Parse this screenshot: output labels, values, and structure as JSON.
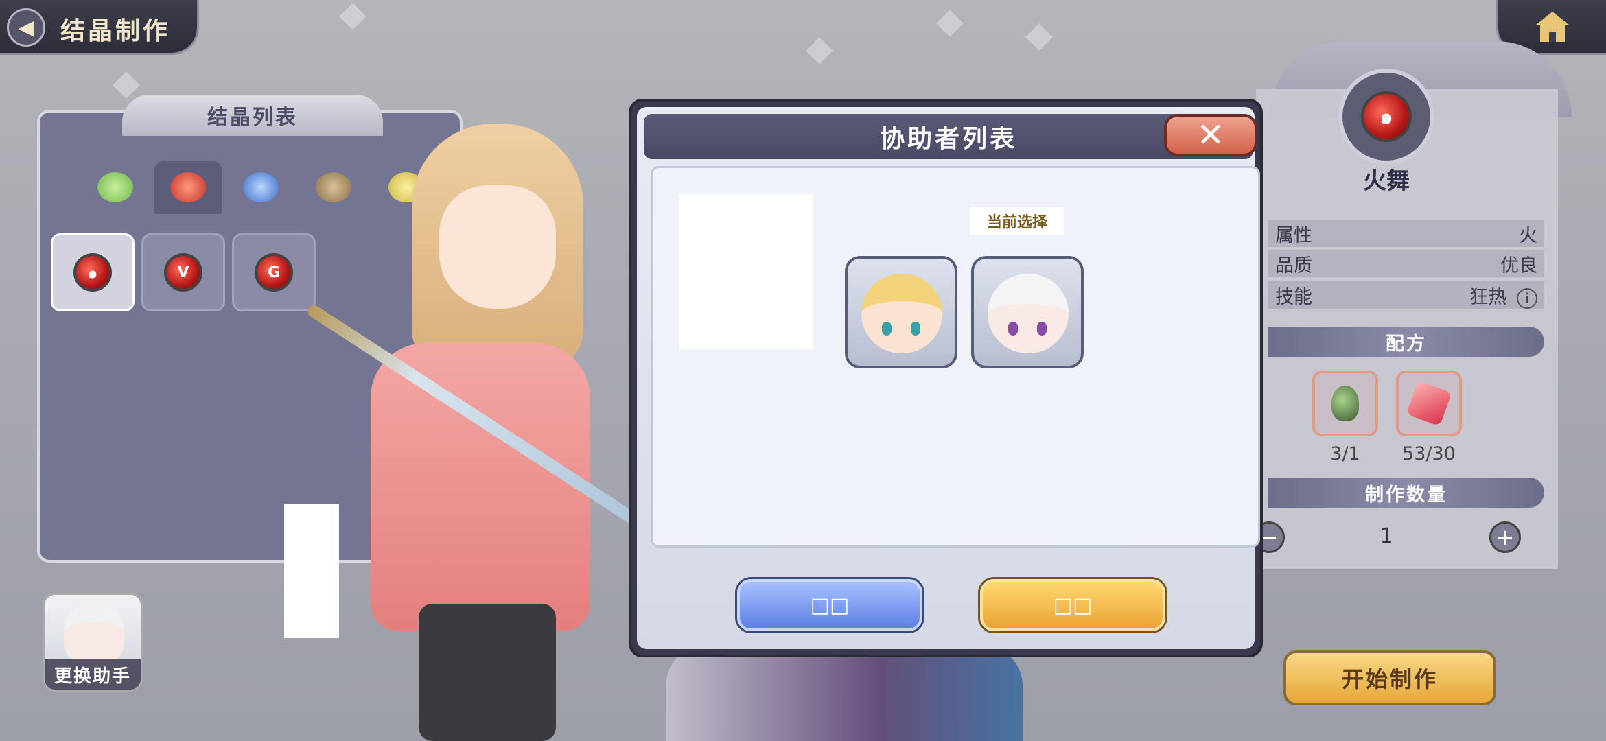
{
  "colors": {
    "accent_gold": "#e7a73a",
    "accent_blue": "#5c7fe4",
    "panel_dark": "#3a3a4f",
    "close_red": "#d2624a"
  },
  "header": {
    "back_icon": "back-arrow-icon",
    "title": "结晶制作",
    "home_icon": "home-icon"
  },
  "crystal_list": {
    "title": "结晶列表",
    "tabs": [
      {
        "icon": "wind-element-icon",
        "color": "#8fd16a",
        "active": false
      },
      {
        "icon": "fire-element-icon",
        "color": "#d84a4a",
        "active": true
      },
      {
        "icon": "water-element-icon",
        "color": "#4d7fd6",
        "active": false
      },
      {
        "icon": "earth-element-icon",
        "color": "#a58a5c",
        "active": false
      },
      {
        "icon": "light-element-icon",
        "color": "#d6c84a",
        "active": false
      },
      {
        "icon": "dark-element-icon",
        "color": "#444444",
        "active": false
      }
    ],
    "items": [
      {
        "icon": "fire-crystal-swirl-icon",
        "glyph": "๑",
        "selected": true
      },
      {
        "icon": "fire-crystal-v-icon",
        "glyph": "V",
        "selected": false
      },
      {
        "icon": "fire-crystal-g-icon",
        "glyph": "G",
        "selected": false
      }
    ]
  },
  "helper_button": {
    "label": "更换助手"
  },
  "detail": {
    "name": "火舞",
    "attributes": [
      {
        "label": "属性",
        "value": "火"
      },
      {
        "label": "品质",
        "value": "优良"
      },
      {
        "label": "技能",
        "value": "狂热"
      }
    ],
    "recipe_title": "配方",
    "materials": [
      {
        "icon": "green-ore-icon",
        "count": "3/1"
      },
      {
        "icon": "red-gem-icon",
        "count": "53/30"
      }
    ],
    "quantity_title": "制作数量",
    "quantity": "1",
    "minus_icon": "minus-icon",
    "plus_icon": "plus-icon",
    "start_button": "开始制作"
  },
  "modal": {
    "title": "协助者列表",
    "close_icon": "close-icon",
    "current_tag": "当前选择",
    "helpers": [
      {
        "icon": "elf-helper-avatar"
      },
      {
        "icon": "silver-hair-helper-avatar"
      }
    ],
    "cancel_label": "□□",
    "confirm_label": "□□"
  }
}
